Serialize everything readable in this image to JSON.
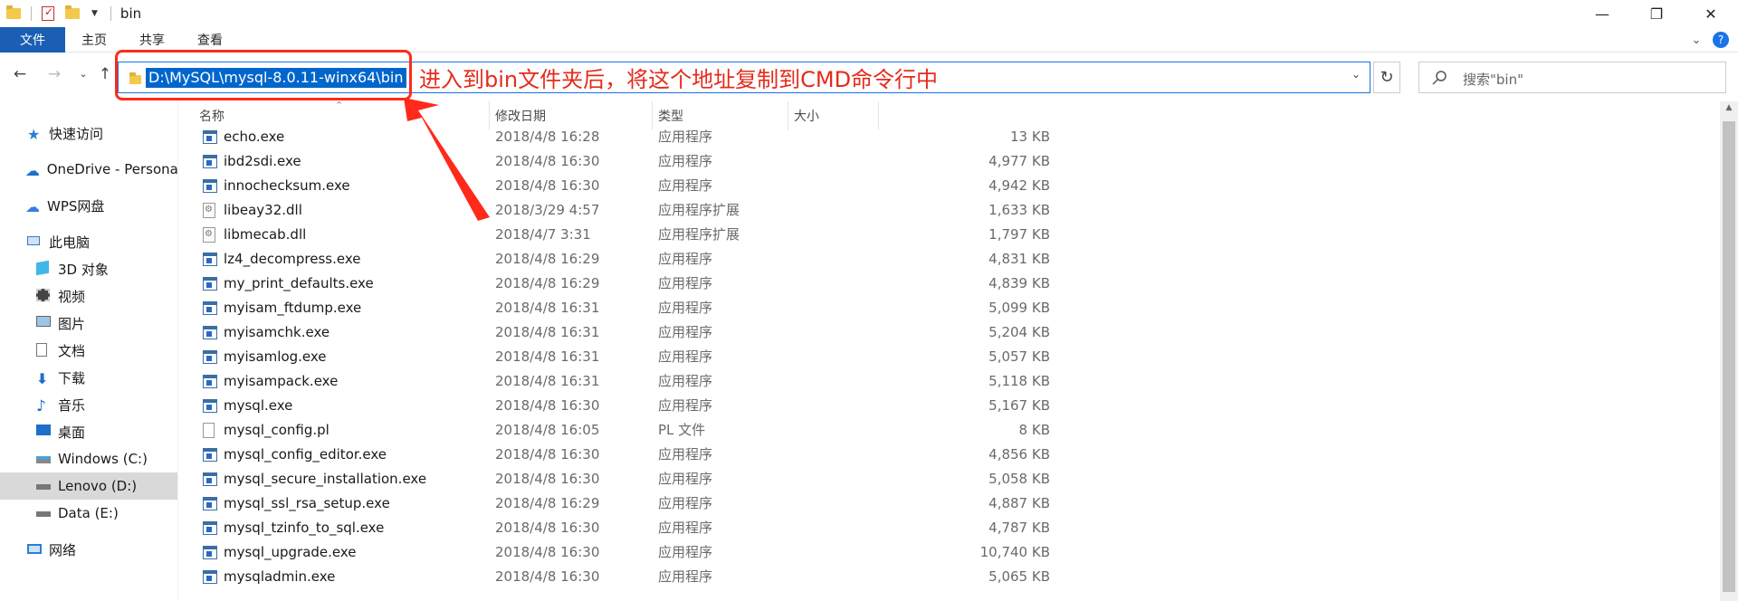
{
  "window": {
    "title": "bin",
    "controls": [
      "minimize",
      "maximize",
      "close"
    ]
  },
  "ribbon": {
    "tabs": [
      "文件",
      "主页",
      "共享",
      "查看"
    ]
  },
  "address": {
    "path": "D:\\MySQL\\mysql-8.0.11-winx64\\bin"
  },
  "search": {
    "placeholder": "搜索\"bin\""
  },
  "annotation": {
    "text": "进入到bin文件夹后，将这个地址复制到CMD命令行中",
    "color": "#e52b1b"
  },
  "sidebar": {
    "items": [
      {
        "label": "快速访问",
        "icon": "star-icon"
      },
      {
        "label": "OneDrive - Persona",
        "icon": "cloud-icon"
      },
      {
        "label": "WPS网盘",
        "icon": "cloud-wps-icon"
      },
      {
        "label": "此电脑",
        "icon": "computer-icon"
      },
      {
        "label": "3D 对象",
        "icon": "cube-icon"
      },
      {
        "label": "视频",
        "icon": "video-icon"
      },
      {
        "label": "图片",
        "icon": "picture-icon"
      },
      {
        "label": "文档",
        "icon": "document-icon"
      },
      {
        "label": "下载",
        "icon": "download-icon"
      },
      {
        "label": "音乐",
        "icon": "music-icon"
      },
      {
        "label": "桌面",
        "icon": "desktop-icon"
      },
      {
        "label": "Windows (C:)",
        "icon": "drive-icon"
      },
      {
        "label": "Lenovo (D:)",
        "icon": "drive-icon"
      },
      {
        "label": "Data (E:)",
        "icon": "drive-icon"
      },
      {
        "label": "网络",
        "icon": "network-icon"
      }
    ],
    "selected": "Lenovo (D:)"
  },
  "columns": {
    "name": "名称",
    "date": "修改日期",
    "type": "类型",
    "size": "大小"
  },
  "files": [
    {
      "name": "echo.exe",
      "date": "2018/4/8 16:28",
      "type": "应用程序",
      "size": "13 KB",
      "icon": "exe-icon"
    },
    {
      "name": "ibd2sdi.exe",
      "date": "2018/4/8 16:30",
      "type": "应用程序",
      "size": "4,977 KB",
      "icon": "exe-icon"
    },
    {
      "name": "innochecksum.exe",
      "date": "2018/4/8 16:30",
      "type": "应用程序",
      "size": "4,942 KB",
      "icon": "exe-icon"
    },
    {
      "name": "libeay32.dll",
      "date": "2018/3/29 4:57",
      "type": "应用程序扩展",
      "size": "1,633 KB",
      "icon": "dll-icon"
    },
    {
      "name": "libmecab.dll",
      "date": "2018/4/7 3:31",
      "type": "应用程序扩展",
      "size": "1,797 KB",
      "icon": "dll-icon"
    },
    {
      "name": "lz4_decompress.exe",
      "date": "2018/4/8 16:29",
      "type": "应用程序",
      "size": "4,831 KB",
      "icon": "exe-icon"
    },
    {
      "name": "my_print_defaults.exe",
      "date": "2018/4/8 16:29",
      "type": "应用程序",
      "size": "4,839 KB",
      "icon": "exe-icon"
    },
    {
      "name": "myisam_ftdump.exe",
      "date": "2018/4/8 16:31",
      "type": "应用程序",
      "size": "5,099 KB",
      "icon": "exe-icon"
    },
    {
      "name": "myisamchk.exe",
      "date": "2018/4/8 16:31",
      "type": "应用程序",
      "size": "5,204 KB",
      "icon": "exe-icon"
    },
    {
      "name": "myisamlog.exe",
      "date": "2018/4/8 16:31",
      "type": "应用程序",
      "size": "5,057 KB",
      "icon": "exe-icon"
    },
    {
      "name": "myisampack.exe",
      "date": "2018/4/8 16:31",
      "type": "应用程序",
      "size": "5,118 KB",
      "icon": "exe-icon"
    },
    {
      "name": "mysql.exe",
      "date": "2018/4/8 16:30",
      "type": "应用程序",
      "size": "5,167 KB",
      "icon": "exe-icon"
    },
    {
      "name": "mysql_config.pl",
      "date": "2018/4/8 16:05",
      "type": "PL 文件",
      "size": "8 KB",
      "icon": "pl-file-icon"
    },
    {
      "name": "mysql_config_editor.exe",
      "date": "2018/4/8 16:30",
      "type": "应用程序",
      "size": "4,856 KB",
      "icon": "exe-icon"
    },
    {
      "name": "mysql_secure_installation.exe",
      "date": "2018/4/8 16:30",
      "type": "应用程序",
      "size": "5,058 KB",
      "icon": "exe-icon"
    },
    {
      "name": "mysql_ssl_rsa_setup.exe",
      "date": "2018/4/8 16:29",
      "type": "应用程序",
      "size": "4,887 KB",
      "icon": "exe-icon"
    },
    {
      "name": "mysql_tzinfo_to_sql.exe",
      "date": "2018/4/8 16:30",
      "type": "应用程序",
      "size": "4,787 KB",
      "icon": "exe-icon"
    },
    {
      "name": "mysql_upgrade.exe",
      "date": "2018/4/8 16:30",
      "type": "应用程序",
      "size": "10,740 KB",
      "icon": "exe-icon"
    },
    {
      "name": "mysqladmin.exe",
      "date": "2018/4/8 16:30",
      "type": "应用程序",
      "size": "5,065 KB",
      "icon": "exe-icon"
    }
  ]
}
